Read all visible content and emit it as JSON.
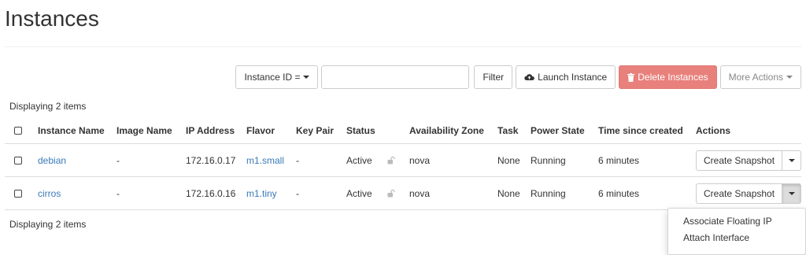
{
  "page": {
    "title": "Instances"
  },
  "toolbar": {
    "filter_field_label": "Instance ID =",
    "filter_input_value": "",
    "filter_button": "Filter",
    "launch_button": "Launch Instance",
    "delete_button": "Delete Instances",
    "more_actions_button": "More Actions"
  },
  "summary": {
    "top": "Displaying 2 items",
    "bottom": "Displaying 2 items"
  },
  "table": {
    "headers": {
      "name": "Instance Name",
      "image": "Image Name",
      "ip": "IP Address",
      "flavor": "Flavor",
      "keypair": "Key Pair",
      "status": "Status",
      "zone": "Availability Zone",
      "task": "Task",
      "power": "Power State",
      "age": "Time since created",
      "actions": "Actions"
    },
    "rows": [
      {
        "name": "debian",
        "image": "-",
        "ip": "172.16.0.17",
        "flavor": "m1.small",
        "keypair": "-",
        "status": "Active",
        "zone": "nova",
        "task": "None",
        "power": "Running",
        "age": "6 minutes",
        "action": "Create Snapshot"
      },
      {
        "name": "cirros",
        "image": "-",
        "ip": "172.16.0.16",
        "flavor": "m1.tiny",
        "keypair": "-",
        "status": "Active",
        "zone": "nova",
        "task": "None",
        "power": "Running",
        "age": "6 minutes",
        "action": "Create Snapshot"
      }
    ]
  },
  "dropdown_menu": {
    "items": [
      "Associate Floating IP",
      "Attach Interface"
    ]
  },
  "colors": {
    "link": "#3a7ab8",
    "danger": "#e8807c"
  }
}
